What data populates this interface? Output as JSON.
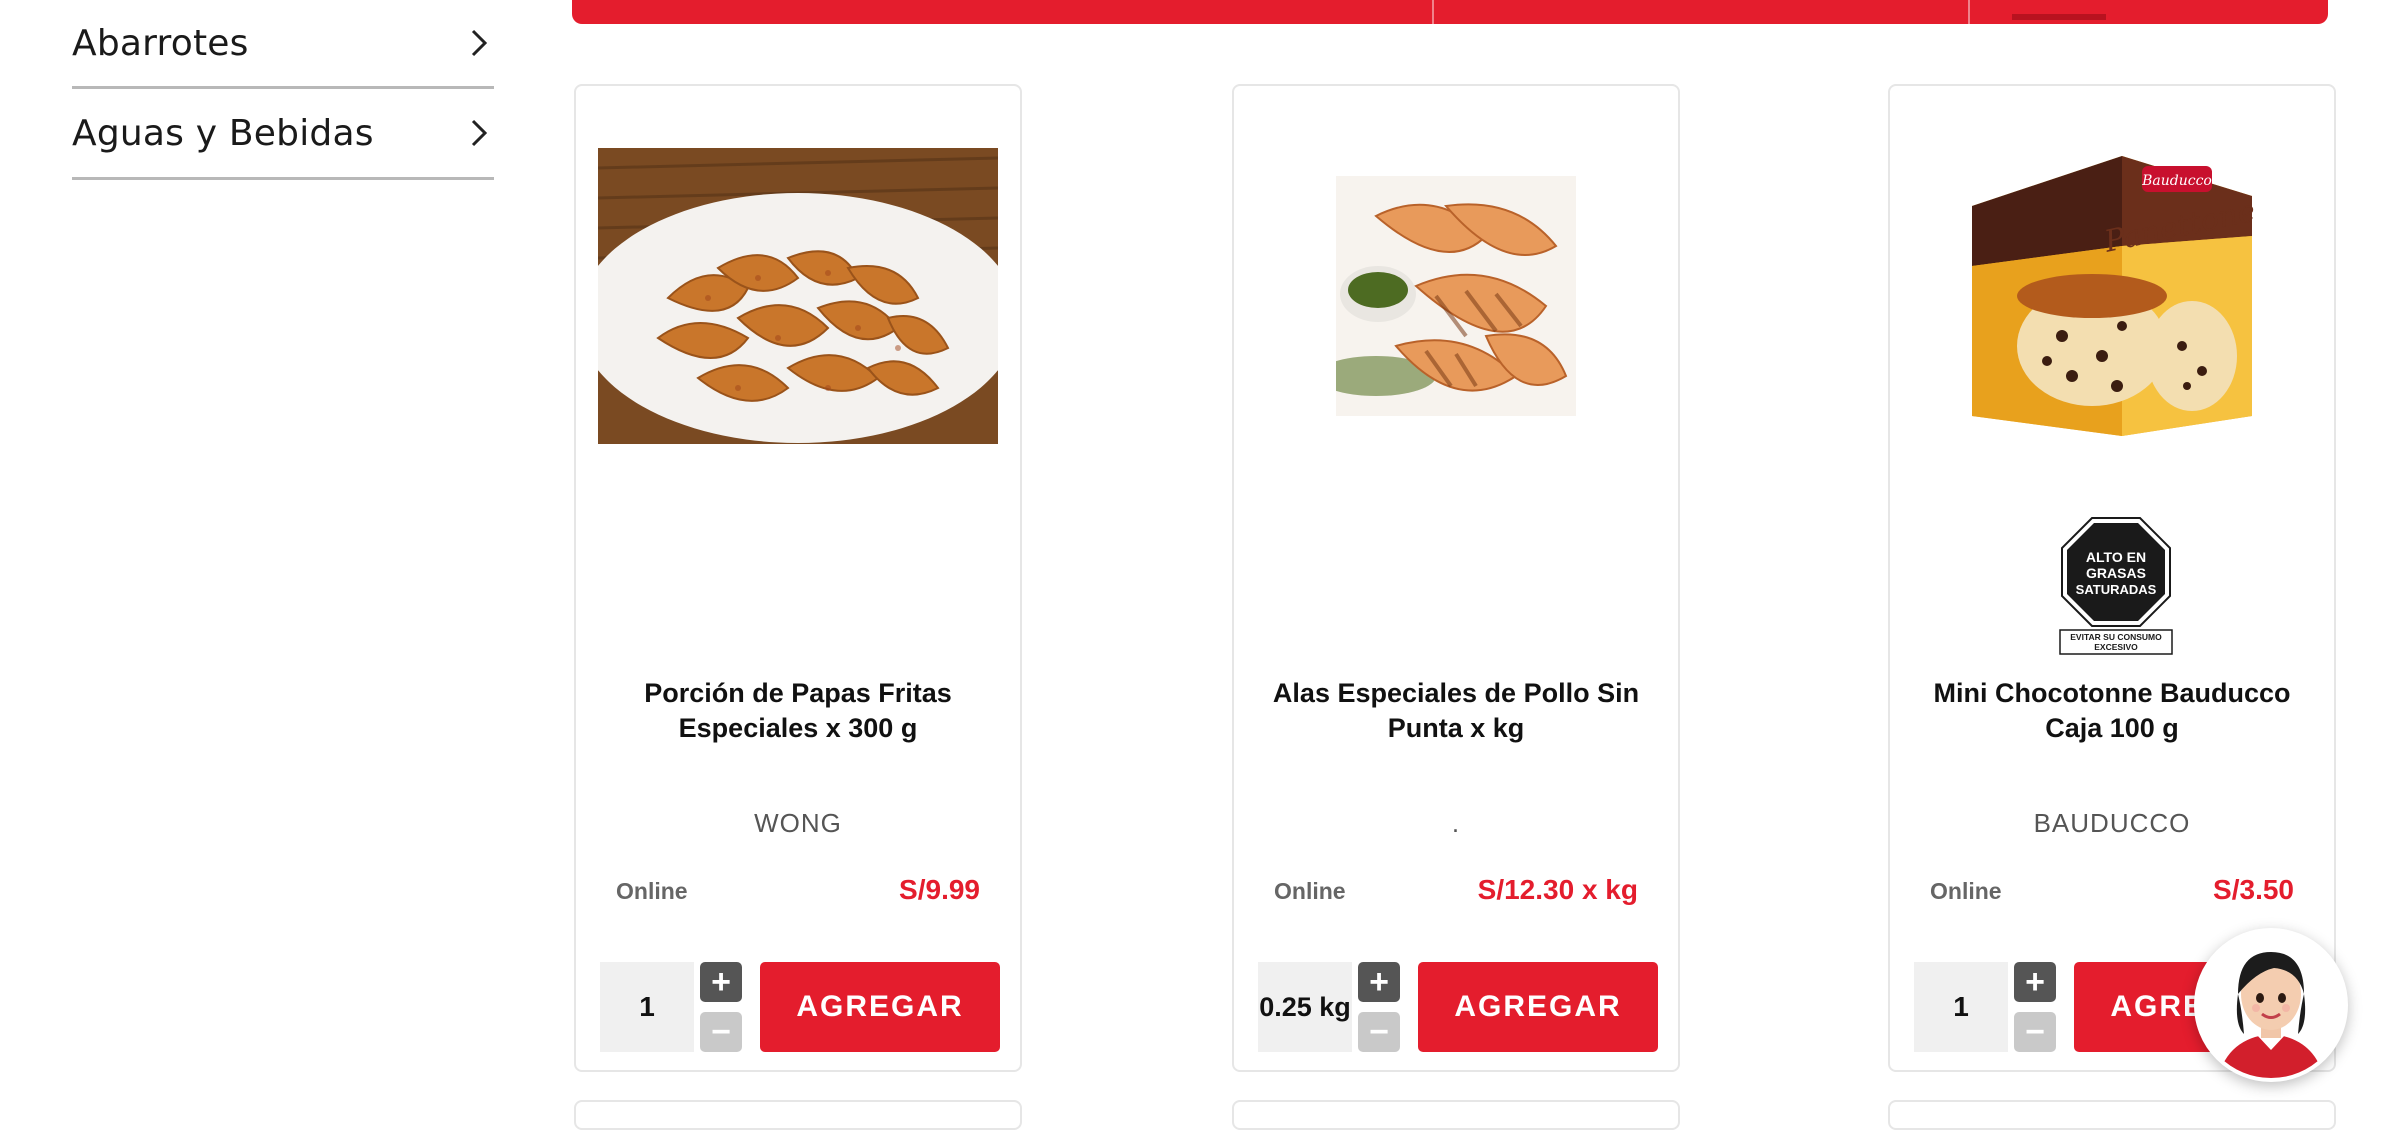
{
  "sidebar": {
    "items": [
      {
        "label": "Abarrotes"
      },
      {
        "label": "Aguas y Bebidas"
      }
    ]
  },
  "products": [
    {
      "title": "Porción de Papas Fritas Especiales x 300 g",
      "brand": "WONG",
      "online_label": "Online",
      "price": "S/9.99",
      "quantity": "1",
      "add_label": "AGREGAR",
      "image": "papas-fritas-image"
    },
    {
      "title": "Alas Especiales de Pollo Sin Punta x kg",
      "brand": ".",
      "online_label": "Online",
      "price": "S/12.30 x kg",
      "quantity": "0.25 kg",
      "add_label": "AGREGAR",
      "image": "alas-pollo-image"
    },
    {
      "title": "Mini Chocotonne Bauducco Caja 100 g",
      "brand": "BAUDUCCO",
      "online_label": "Online",
      "price": "S/3.50",
      "quantity": "1",
      "add_label": "AGREGAR",
      "image": "chocotonne-image",
      "warning": {
        "lines": [
          "ALTO EN",
          "GRASAS",
          "SATURADAS"
        ],
        "footer": [
          "EVITAR SU CONSUMO",
          "EXCESIVO"
        ]
      }
    }
  ],
  "stepper": {
    "plus": "+",
    "minus": "−"
  },
  "colors": {
    "accent": "#e41d2d",
    "text": "#111111",
    "muted": "#555555"
  }
}
